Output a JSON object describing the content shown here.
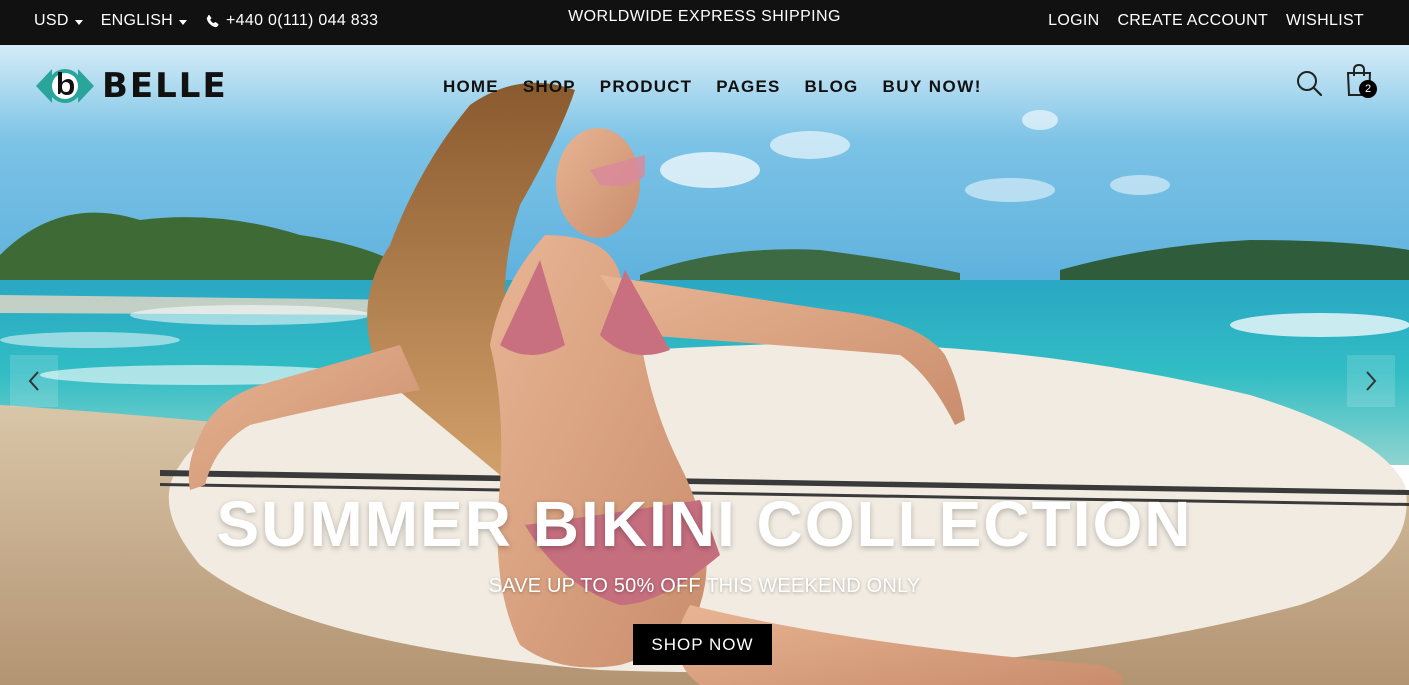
{
  "topbar": {
    "currency": "USD",
    "language": "ENGLISH",
    "phone": "+440 0(111) 044 833",
    "promo": "WORLDWIDE EXPRESS SHIPPING",
    "login": "LOGIN",
    "create_account": "CREATE ACCOUNT",
    "wishlist": "WISHLIST"
  },
  "header": {
    "logo_text": "BELLE",
    "nav": [
      "HOME",
      "SHOP",
      "PRODUCT",
      "PAGES",
      "BLOG",
      "BUY NOW!"
    ],
    "cart_count": "2"
  },
  "slide": {
    "title": "SUMMER BIKINI COLLECTION",
    "subtitle": "SAVE UP TO 50% OFF THIS WEEKEND ONLY",
    "button": "SHOP NOW"
  },
  "colors": {
    "topbar_bg": "#111111",
    "logo_teal": "#2aa59b",
    "button_bg": "#000000"
  }
}
